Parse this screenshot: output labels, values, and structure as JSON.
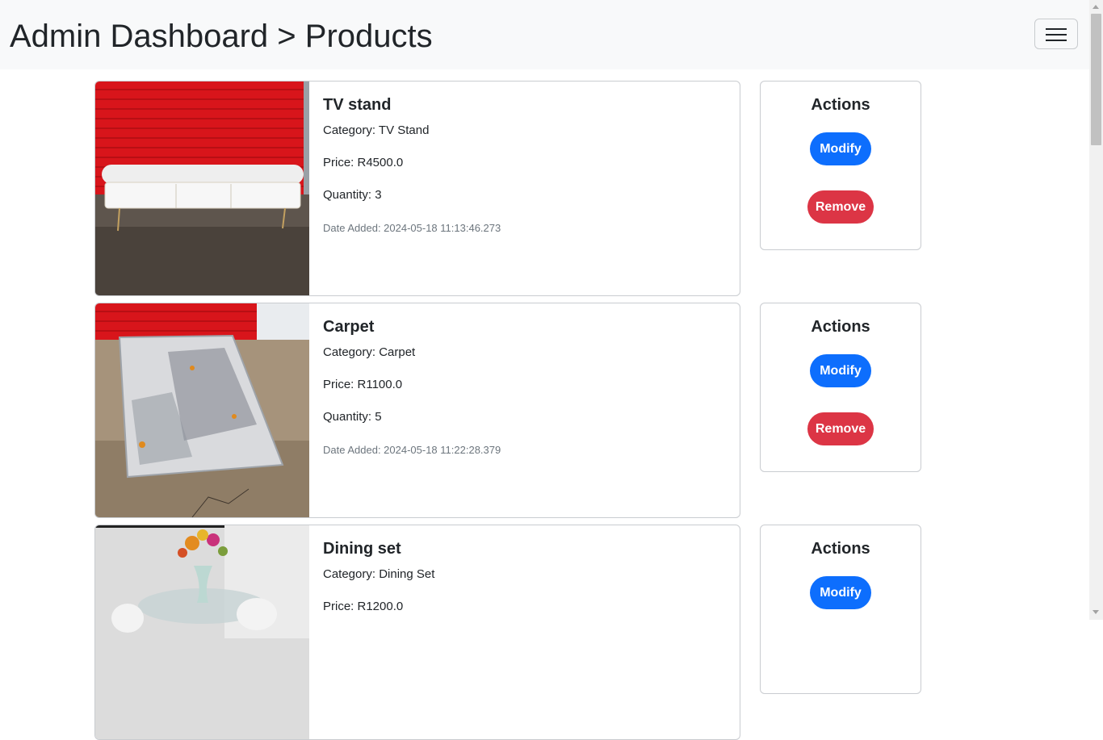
{
  "navbar": {
    "brand": "Admin Dashboard > Products",
    "toggler_icon": "hamburger-menu-icon"
  },
  "products": [
    {
      "name": "TV stand",
      "category": "Category: TV Stand",
      "price": "Price: R4500.0",
      "quantity": "Quantity: 3",
      "date_added": "Date Added: 2024-05-18 11:13:46.273"
    },
    {
      "name": "Carpet",
      "category": "Category: Carpet",
      "price": "Price: R1100.0",
      "quantity": "Quantity: 5",
      "date_added": "Date Added: 2024-05-18 11:22:28.379"
    },
    {
      "name": "Dining set",
      "category": "Category: Dining Set",
      "price": "Price: R1200.0",
      "quantity": "",
      "date_added": ""
    }
  ],
  "actions": {
    "title": "Actions",
    "modify_label": "Modify",
    "remove_label": "Remove"
  },
  "colors": {
    "primary": "#0d6efd",
    "danger": "#dc3545",
    "navbar_bg": "#f8f9fa"
  }
}
